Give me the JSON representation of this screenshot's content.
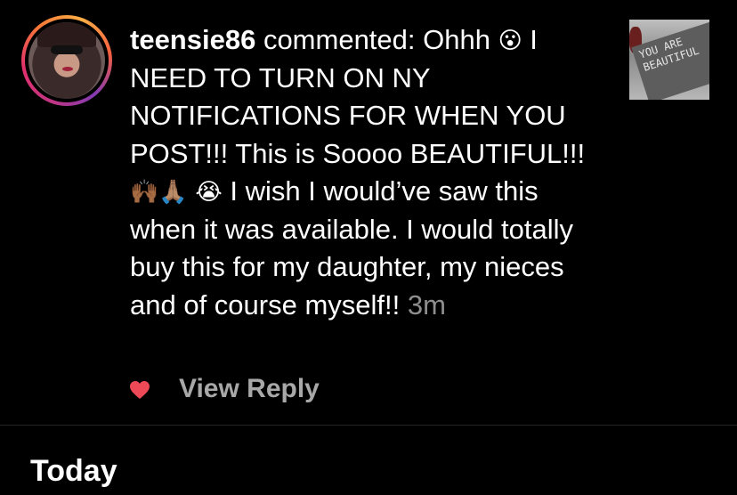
{
  "notification": {
    "username": "teensie86",
    "action_text": " commented: Ohhh ",
    "emoji_1": "😮",
    "text_1": " I NEED TO TURN ON NY NOTIFICATIONS FOR WHEN YOU POST!!! This is Soooo BEAUTIFUL!!! ",
    "emoji_2": "🙌🏾🙏🏽",
    "emoji_3": "😭",
    "text_2": "  I wish I would’ve saw this when it was available. I would totally buy this for my daughter, my nieces and of course myself!! ",
    "time": "3m",
    "thumbnail_text": "YOU ARE BEAUTIFUL",
    "view_reply_label": "View Reply",
    "heart_color": "#ed4956"
  },
  "section": {
    "title": "Today"
  },
  "icons": {
    "like": "heart-icon"
  }
}
